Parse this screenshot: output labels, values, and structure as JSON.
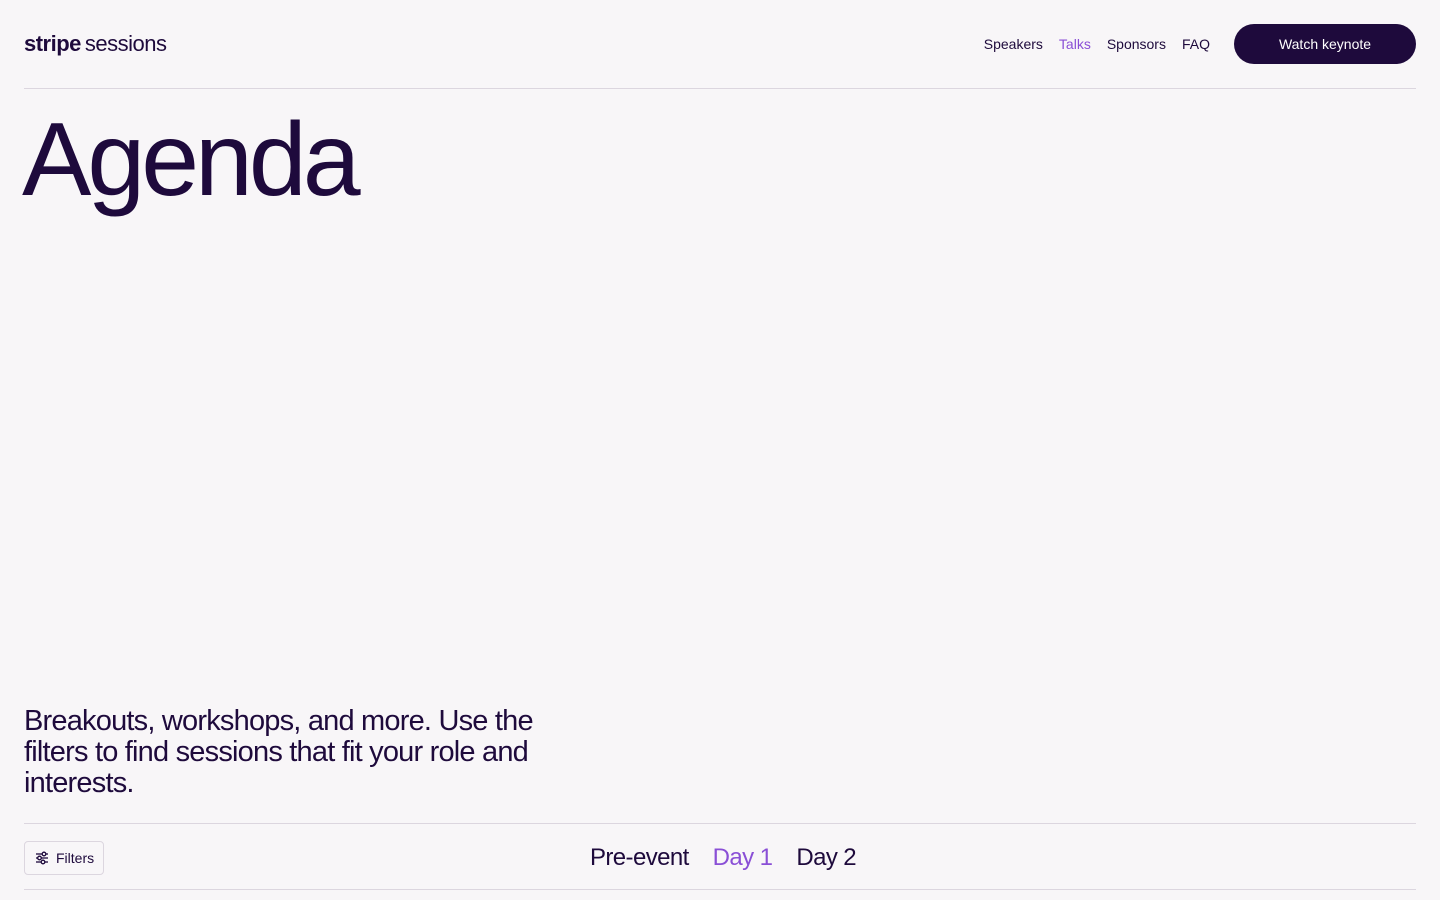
{
  "header": {
    "logo": {
      "brand": "stripe",
      "product": "sessions"
    },
    "nav": [
      {
        "label": "Speakers",
        "active": false
      },
      {
        "label": "Talks",
        "active": true
      },
      {
        "label": "Sponsors",
        "active": false
      },
      {
        "label": "FAQ",
        "active": false
      }
    ],
    "cta_label": "Watch keynote"
  },
  "hero": {
    "title": "Agenda",
    "intro": "Breakouts, workshops, and more. Use the filters to find sessions that fit your role and interests."
  },
  "toolbar": {
    "filters_label": "Filters",
    "filters_icon": "sliders-icon",
    "tabs": [
      {
        "label": "Pre-event",
        "active": false
      },
      {
        "label": "Day 1",
        "active": true
      },
      {
        "label": "Day 2",
        "active": false
      }
    ]
  },
  "colors": {
    "background": "#f8f6f8",
    "text": "#1e0a3c",
    "accent": "#8a4fd6",
    "divider": "#dcd6df"
  }
}
